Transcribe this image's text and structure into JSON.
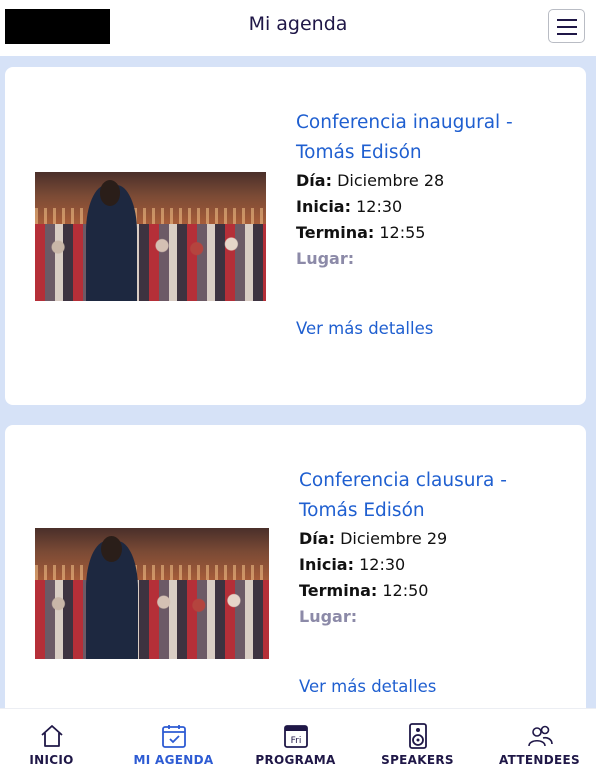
{
  "header": {
    "title": "Mi agenda"
  },
  "sessions": [
    {
      "title": "Conferencia inaugural - Tomás Edisón",
      "dia_label": "Día:",
      "dia": "Diciembre 28",
      "inicia_label": "Inicia:",
      "inicia": "12:30",
      "termina_label": "Termina:",
      "termina": "12:55",
      "lugar_label": "Lugar:",
      "lugar": "",
      "details_label": "Ver más detalles"
    },
    {
      "title": "Conferencia clausura - Tomás Edisón",
      "dia_label": "Día:",
      "dia": "Diciembre 29",
      "inicia_label": "Inicia:",
      "inicia": "12:30",
      "termina_label": "Termina:",
      "termina": "12:50",
      "lugar_label": "Lugar:",
      "lugar": "",
      "details_label": "Ver más detalles"
    }
  ],
  "nav": [
    {
      "label": "INICIO",
      "icon": "home-icon"
    },
    {
      "label": "MI AGENDA",
      "icon": "calendar-check-icon",
      "active": true
    },
    {
      "label": "PROGRAMA",
      "icon": "calendar-fri-icon",
      "icon_text": "Fri"
    },
    {
      "label": "SPEAKERS",
      "icon": "speaker-icon"
    },
    {
      "label": "ATTENDEES",
      "icon": "people-icon"
    }
  ],
  "colors": {
    "accent": "#1f5fd0",
    "nav_active": "#2d5bd3",
    "background": "#d6e2f7",
    "title_dark": "#1f1747"
  }
}
